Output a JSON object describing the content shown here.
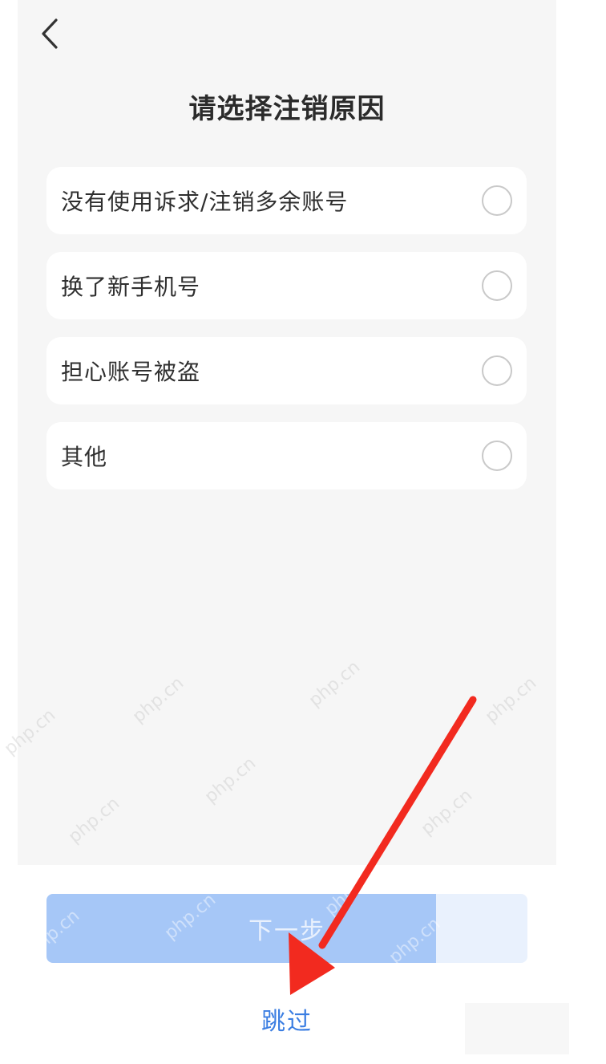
{
  "header": {
    "title": "请选择注销原因"
  },
  "options": [
    {
      "label": "没有使用诉求/注销多余账号",
      "selected": false
    },
    {
      "label": "换了新手机号",
      "selected": false
    },
    {
      "label": "担心账号被盗",
      "selected": false
    },
    {
      "label": "其他",
      "selected": false
    }
  ],
  "footer": {
    "next_label": "下一步",
    "skip_label": "跳过"
  },
  "watermark": {
    "text": "php.cn"
  },
  "colors": {
    "accent": "#3b7ee2",
    "button_disabled": "#a6c7f7",
    "annotation_arrow": "#f22a1f"
  },
  "icons": {
    "back": "chevron-left-icon",
    "radio": "radio-unchecked-icon"
  }
}
